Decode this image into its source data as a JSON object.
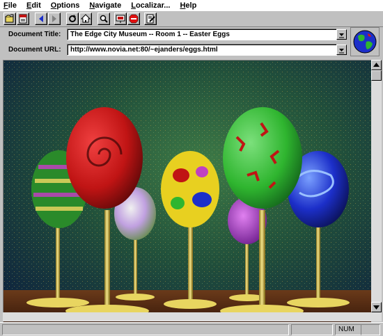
{
  "menu": {
    "file": {
      "key": "F",
      "rest": "ile"
    },
    "edit": {
      "key": "E",
      "rest": "dit"
    },
    "options": {
      "key": "O",
      "rest": "ptions"
    },
    "navigate": {
      "key": "N",
      "rest": "avigate"
    },
    "localizar": {
      "key": "L",
      "rest": "ocalizar..."
    },
    "help": {
      "key": "H",
      "rest": "elp"
    }
  },
  "toolbar": {
    "icons": [
      "open-file-icon",
      "save-document-icon",
      "back-arrow-icon",
      "forward-arrow-icon",
      "reload-icon",
      "home-icon",
      "search-magnifier-icon",
      "hotlist-icon",
      "stop-icon",
      "page-edit-icon"
    ]
  },
  "document": {
    "title_label": "Document Title:",
    "title_value": "The Edge City Museum -- Room 1 -- Easter Eggs",
    "url_label": "Document URL:",
    "url_value": "http://www.novia.net:80/~ejanders/eggs.html"
  },
  "status": {
    "num_indicator": "NUM"
  },
  "colors": {
    "chrome": "#c0c0c0",
    "egg_red": "#c01414",
    "egg_green": "#2fb52f",
    "egg_blue": "#1c2fc9",
    "gold": "#e8d560"
  }
}
